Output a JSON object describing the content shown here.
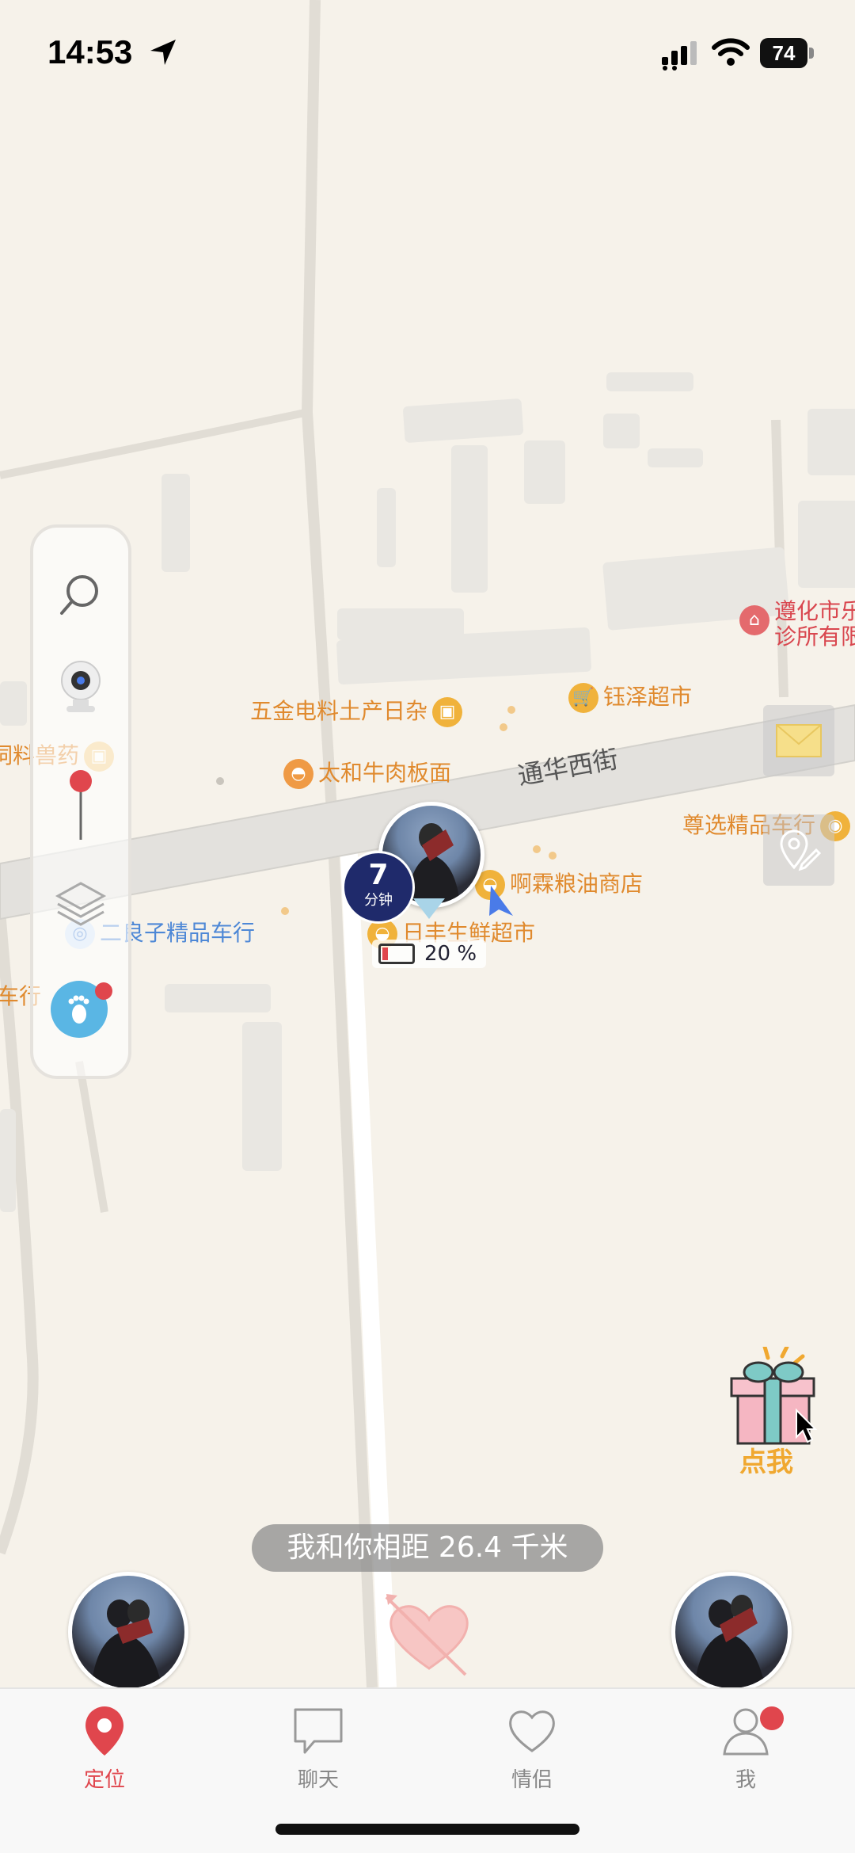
{
  "status_bar": {
    "time": "14:53",
    "battery": "74"
  },
  "map": {
    "road_name": "通华西街",
    "pois": {
      "hardware": "五金电料土产日杂",
      "yuze": "钰泽超市",
      "beef_noodle": "太和牛肉板面",
      "feed": "饲料兽药",
      "grain": "啊霖粮油商店",
      "fresh": "日丰生鲜超市",
      "car_shop": "二良子精品车行",
      "car_shop_left": "车行",
      "zunxuan": "尊选精品车行",
      "dental_1": "遵化市乐",
      "dental_2": "诊所有限"
    }
  },
  "partner_pin": {
    "minutes": "7",
    "minutes_unit": "分钟",
    "battery": "20 %",
    "battery_level": 0.2
  },
  "distance_text": "我和你相距 26.4 千米",
  "gift_label": "点我",
  "tabs": [
    {
      "label": "定位",
      "active": true
    },
    {
      "label": "聊天",
      "active": false
    },
    {
      "label": "情侣",
      "active": false
    },
    {
      "label": "我",
      "active": false
    }
  ],
  "colors": {
    "accent": "#e0464d",
    "poi_orange": "#e08a2e",
    "poi_blue": "#4e88d6",
    "map_bg": "#f6f2ea"
  }
}
